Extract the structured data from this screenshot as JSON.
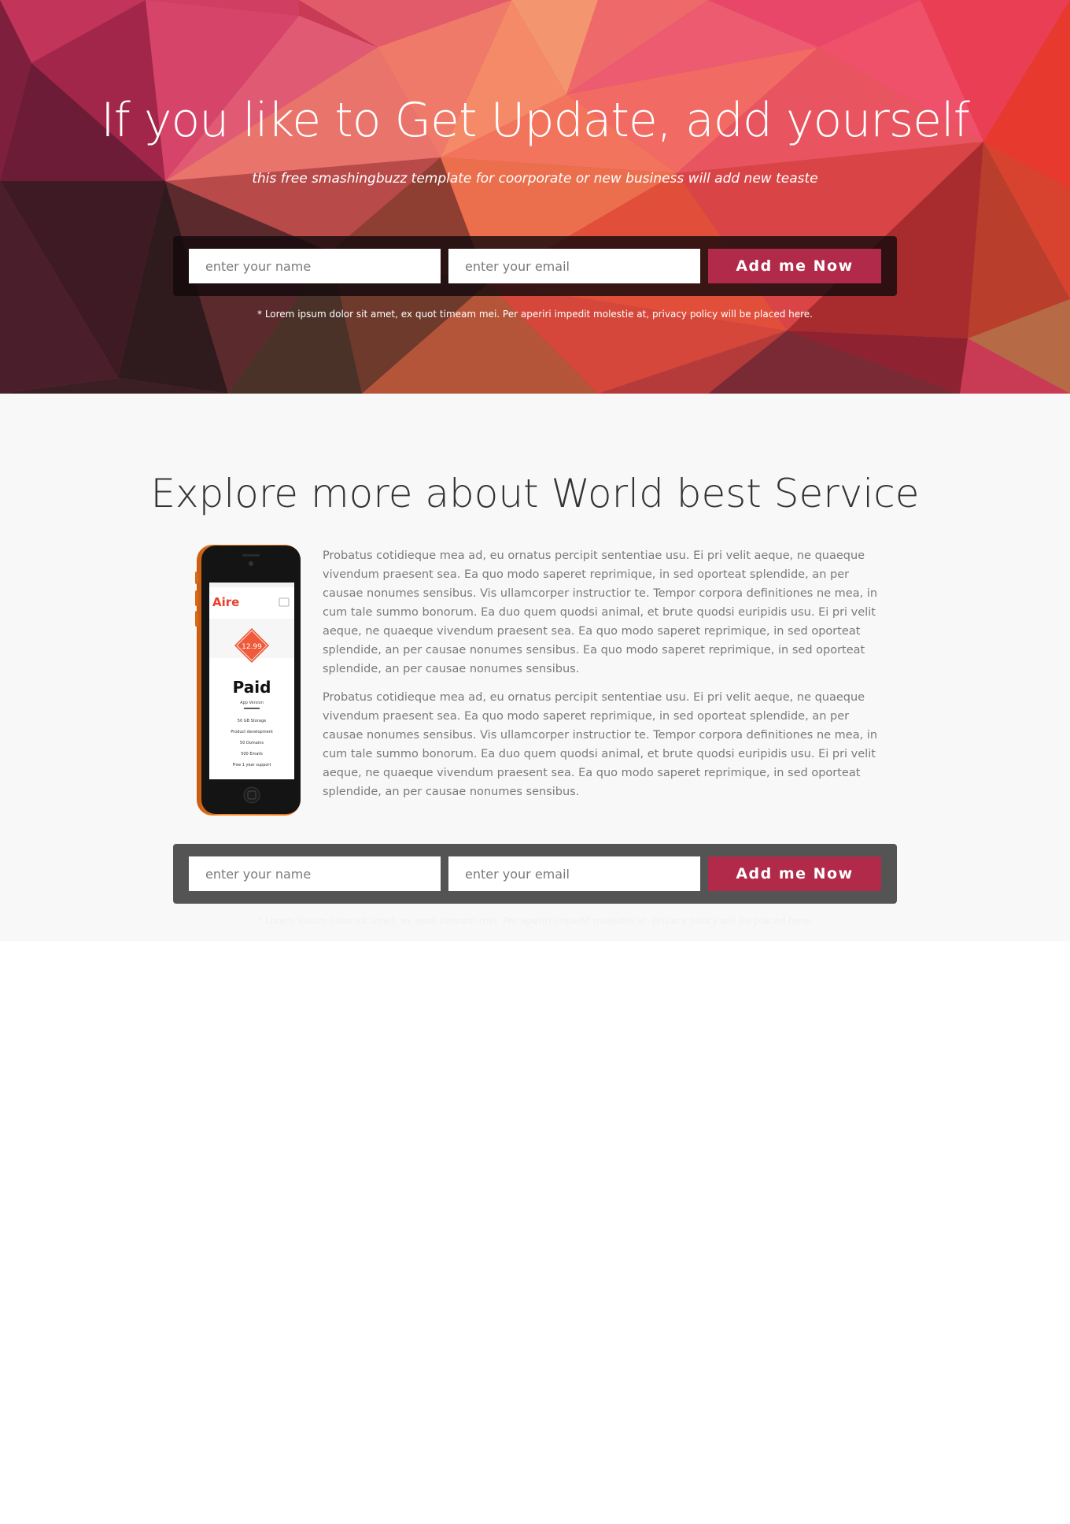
{
  "hero": {
    "title": "If you like to Get Update, add yourself",
    "subtitle": "this free smashingbuzz template for coorporate or new business will add new teaste",
    "form": {
      "name_placeholder": "enter your name",
      "email_placeholder": "enter your email",
      "submit_label": "Add me Now"
    },
    "disclaimer": "* Lorem ipsum dolor sit amet, ex quot timeam mei. Per aperiri impedit molestie at, privacy policy will be placed here."
  },
  "services": {
    "title": "Explore more about World best Service",
    "paragraphs": [
      "Probatus cotidieque mea ad, eu ornatus percipit sententiae usu. Ei pri velit aeque, ne quaeque vivendum praesent sea. Ea quo modo saperet reprimique, in sed oporteat splendide, an per causae nonumes sensibus. Vis ullamcorper instructior te. Tempor corpora definitiones ne mea, in cum tale summo bonorum. Ea duo quem quodsi animal, et brute quodsi euripidis usu. Ei pri velit aeque, ne quaeque vivendum praesent sea. Ea quo modo saperet reprimique, in sed oporteat splendide, an per causae nonumes sensibus. Ea quo modo saperet reprimique, in sed oporteat splendide, an per causae nonumes sensibus.",
      "Probatus cotidieque mea ad, eu ornatus percipit sententiae usu. Ei pri velit aeque, ne quaeque vivendum praesent sea. Ea quo modo saperet reprimique, in sed oporteat splendide, an per causae nonumes sensibus. Vis ullamcorper instructior te. Tempor corpora definitiones ne mea, in cum tale summo bonorum. Ea duo quem quodsi animal, et brute quodsi euripidis usu. Ei pri velit aeque, ne quaeque vivendum praesent sea. Ea quo modo saperet reprimique, in sed oporteat splendide, an per causae nonumes sensibus."
    ],
    "phone": {
      "brand": "Aire",
      "price": "12.99",
      "plan": "Paid",
      "plan_sub": "App Version",
      "features": [
        "50 GB Storage",
        "Product development",
        "50 Domains",
        "500 Emails",
        "Free 1 year support"
      ]
    },
    "form": {
      "name_placeholder": "enter your name",
      "email_placeholder": "enter your email",
      "submit_label": "Add me Now"
    },
    "disclaimer": "* Lorem ipsum dolor sit amet, ex quot timeam mei. Per aperiri impedit molestie at, privacy policy will be placed here."
  },
  "colors": {
    "accent_button": "#b12a4a",
    "hero_pink": "#e8456a",
    "hero_orange": "#f07a4f",
    "section_bg": "#f8f8f8",
    "form_bar_grey": "#545454",
    "phone_orange": "#f07b1c"
  }
}
